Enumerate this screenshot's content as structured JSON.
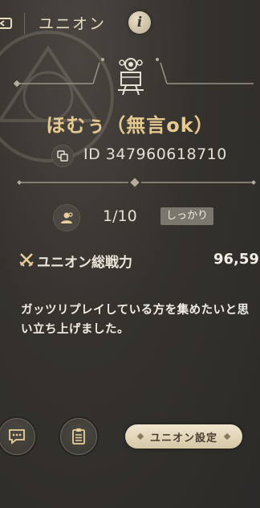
{
  "header": {
    "title": "ユニオン",
    "info_label": "i"
  },
  "union": {
    "name": "ほむぅ（無言ok）",
    "id_label": "ID 347960618710",
    "member_count": "1/10",
    "tag": "しっかり",
    "power_label": "ユニオン総戦力",
    "power_value": "96,59",
    "description": "ガッツリプレイしている方を集めたいと思い立ち上げました。"
  },
  "actions": {
    "settings_label": "ユニオン設定"
  },
  "colors": {
    "background": "#35322e",
    "name_gold": "#e6c98f",
    "tag_bg": "#7b776f",
    "settings_bg": "#e5d9bd"
  },
  "icons": [
    "back-icon",
    "info-icon",
    "union-emblem-icon",
    "copy-icon",
    "members-icon",
    "swords-icon",
    "chat-icon",
    "memo-icon"
  ]
}
